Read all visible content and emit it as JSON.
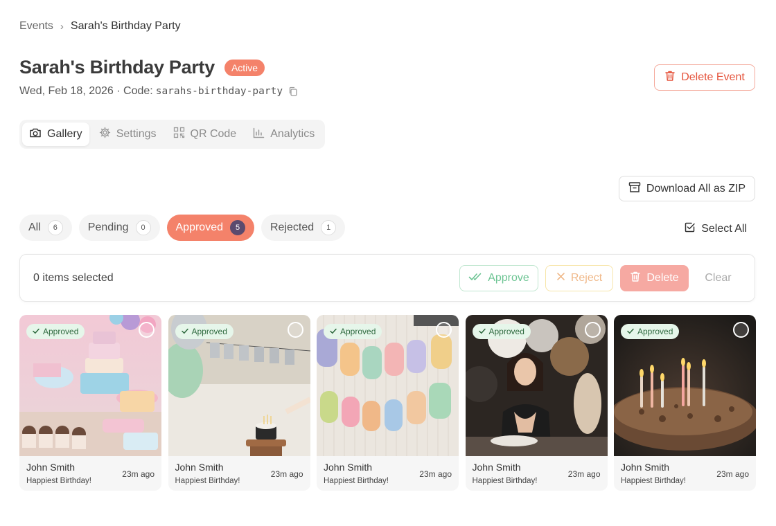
{
  "breadcrumb": {
    "parent": "Events",
    "separator": "›",
    "current": "Sarah's Birthday Party"
  },
  "event": {
    "title": "Sarah's Birthday Party",
    "status": "Active",
    "date_prefix": "Wed, Feb 18, 2026 · Code:",
    "code": "sarahs-birthday-party"
  },
  "actions": {
    "delete_event": "Delete Event",
    "download_zip": "Download All as ZIP",
    "select_all": "Select All"
  },
  "tabs": [
    {
      "label": "Gallery",
      "icon": "camera-icon",
      "active": true
    },
    {
      "label": "Settings",
      "icon": "gear-icon",
      "active": false
    },
    {
      "label": "QR Code",
      "icon": "qr-code-icon",
      "active": false
    },
    {
      "label": "Analytics",
      "icon": "bar-chart-icon",
      "active": false
    }
  ],
  "filters": [
    {
      "label": "All",
      "count": "6",
      "active": false
    },
    {
      "label": "Pending",
      "count": "0",
      "active": false
    },
    {
      "label": "Approved",
      "count": "5",
      "active": true
    },
    {
      "label": "Rejected",
      "count": "1",
      "active": false
    }
  ],
  "selection": {
    "text": "0 items selected",
    "approve": "Approve",
    "reject": "Reject",
    "delete": "Delete",
    "clear": "Clear"
  },
  "photos": [
    {
      "badge": "Approved",
      "name": "John Smith",
      "message": "Happiest Birthday!",
      "time": "23m ago"
    },
    {
      "badge": "Approved",
      "name": "John Smith",
      "message": "Happiest Birthday!",
      "time": "23m ago"
    },
    {
      "badge": "Approved",
      "name": "John Smith",
      "message": "Happiest Birthday!",
      "time": "23m ago"
    },
    {
      "badge": "Approved",
      "name": "John Smith",
      "message": "Happiest Birthday!",
      "time": "23m ago"
    },
    {
      "badge": "Approved",
      "name": "John Smith",
      "message": "Happiest Birthday!",
      "time": "23m ago"
    }
  ],
  "colors": {
    "accent": "#f4826a",
    "danger": "#e5533b",
    "approve": "#6cc493",
    "count_active": "#5b4a6e"
  }
}
